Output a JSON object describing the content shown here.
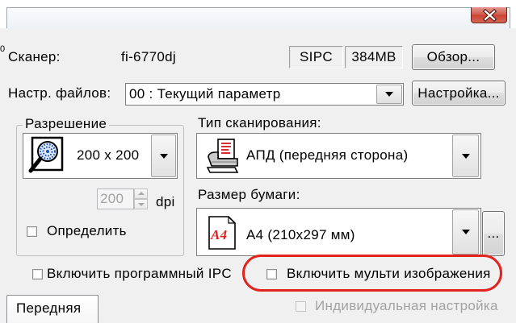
{
  "title_bar": {
    "close_icon": "close-icon"
  },
  "scanner": {
    "edge_glyph": "0",
    "label": "Сканер:",
    "model": "fi-6770dj",
    "interface": "SIPC",
    "memory": "384MB",
    "browse_button": "Обзор..."
  },
  "file_settings": {
    "label": "Настр. файлов:",
    "selected": "00 : Текущий параметр",
    "setup_button": "Настройка..."
  },
  "resolution": {
    "group_title": "Разрешение",
    "icon": "resolution-icon",
    "selected": "200 x 200",
    "custom_value": "200",
    "custom_unit": "dpi",
    "custom_enabled": false,
    "detect": {
      "label": "Определить",
      "checked": false
    }
  },
  "scan_type": {
    "label": "Тип сканирования:",
    "icon": "adf-scanner-icon",
    "selected": "АПД (передняя сторона)"
  },
  "paper_size": {
    "label": "Размер бумаги:",
    "icon": "paper-a4-icon",
    "icon_text": "A4",
    "selected": "A4 (210x297 мм)",
    "more_button": "..."
  },
  "options": {
    "software_ipc": {
      "label": "Включить программный IPC",
      "checked": false
    },
    "multi_image": {
      "label": "Включить мульти изображения",
      "checked": false,
      "highlighted": true
    }
  },
  "tabs": [
    {
      "label": "Передняя",
      "active": true
    }
  ],
  "individual_settings": {
    "label": "Индивидуальная настройка",
    "checked": false,
    "enabled": false
  },
  "colors": {
    "dialog_background": "#F0F0F0",
    "close_button": "#CB4332",
    "highlight_ring": "#E0231D",
    "icon_accent_red": "#E0201C",
    "disabled_text": "#A3A3A3"
  }
}
